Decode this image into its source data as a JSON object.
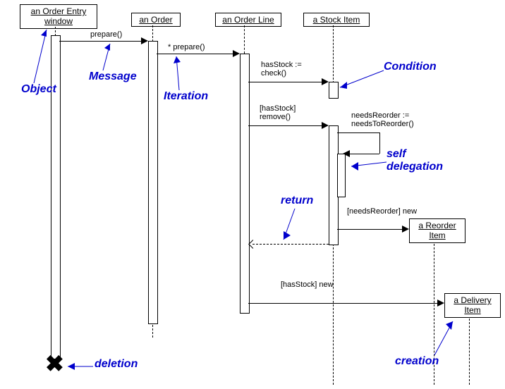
{
  "participants": {
    "orderEntryWindow": "an Order Entry\nwindow",
    "order": "an Order",
    "orderLine": "an Order Line",
    "stockItem": "a Stock Item",
    "reorderItem": "a Reorder\nItem",
    "deliveryItem": "a Delivery\nItem"
  },
  "messages": {
    "prepare1": "prepare()",
    "prepare2": "* prepare()",
    "check": "hasStock :=\ncheck()",
    "remove": "[hasStock]\nremove()",
    "needsReorder": "needsReorder :=\nneedsToReorder()",
    "newReorder": "[needsReorder] new",
    "newDelivery": "[hasStock] new"
  },
  "annotations": {
    "object": "Object",
    "message": "Message",
    "iteration": "Iteration",
    "condition": "Condition",
    "selfDelegation": "self\ndelegation",
    "return": "return",
    "deletion": "deletion",
    "creation": "creation"
  }
}
